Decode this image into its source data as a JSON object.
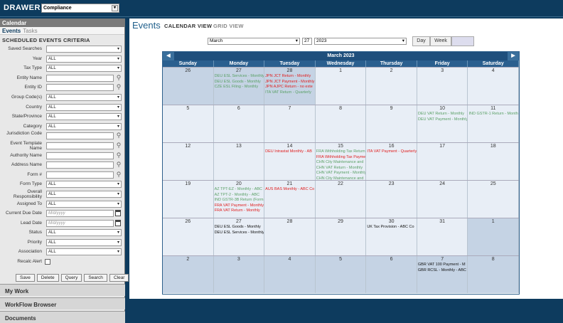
{
  "drawer": {
    "label": "DRAWER :",
    "value": "Compliance"
  },
  "sidebar": {
    "header": "Calendar",
    "tabs": [
      "Events",
      "Tasks"
    ],
    "criteria_title": "SCHEDULED EVENTS CRITERIA",
    "fields": [
      {
        "label": "Saved Searches",
        "type": "select",
        "value": ""
      },
      {
        "label": "Year",
        "type": "select",
        "value": "ALL"
      },
      {
        "label": "Tax Type",
        "type": "select",
        "value": "ALL"
      },
      {
        "label": "Entity Name",
        "type": "lookup",
        "value": ""
      },
      {
        "label": "Entity ID",
        "type": "lookup",
        "value": ""
      },
      {
        "label": "Group Code(s)",
        "type": "select",
        "value": "ALL"
      },
      {
        "label": "Country",
        "type": "select",
        "value": "ALL"
      },
      {
        "label": "State/Province",
        "type": "select",
        "value": "ALL"
      },
      {
        "label": "Category",
        "type": "select",
        "value": "ALL"
      },
      {
        "label": "Jurisdiction Code",
        "type": "lookup",
        "value": ""
      },
      {
        "label": "Event Template Name",
        "type": "lookup",
        "value": ""
      },
      {
        "label": "Authority Name",
        "type": "lookup",
        "value": ""
      },
      {
        "label": "Address Name",
        "type": "lookup",
        "value": ""
      },
      {
        "label": "Form #",
        "type": "lookup",
        "value": ""
      },
      {
        "label": "Form Type",
        "type": "select",
        "value": "ALL"
      },
      {
        "label": "Overall Responsibility",
        "type": "select",
        "value": "ALL"
      },
      {
        "label": "Assigned To",
        "type": "select",
        "value": "ALL"
      },
      {
        "label": "Current Due Date",
        "type": "date",
        "value": "M/d/yyyy"
      },
      {
        "label": "Lead Date",
        "type": "date",
        "value": "M/d/yyyy"
      },
      {
        "label": "Status",
        "type": "select",
        "value": "ALL"
      },
      {
        "label": "Priority",
        "type": "select",
        "value": "ALL"
      },
      {
        "label": "Association",
        "type": "select",
        "value": "ALL"
      },
      {
        "label": "Recalc Alert",
        "type": "check",
        "value": ""
      }
    ],
    "buttons": [
      "Save",
      "Delete",
      "Query",
      "Search",
      "Clear"
    ],
    "accordions": [
      "My Work",
      "WorkFlow Browser",
      "Documents"
    ]
  },
  "main": {
    "title": "Events",
    "views": [
      "CALENDAR VIEW",
      "GRID VIEW"
    ],
    "month_select": "March",
    "day_input": "27",
    "year_select": "2023",
    "view_buttons": [
      "Day",
      "Week",
      "Month"
    ],
    "calendar_title": "March 2023",
    "dows": [
      "Sunday",
      "Monday",
      "Tuesday",
      "Wednesday",
      "Thursday",
      "Friday",
      "Saturday"
    ],
    "weeks": [
      [
        {
          "d": "26",
          "o": true,
          "ev": []
        },
        {
          "d": "27",
          "o": true,
          "ev": [
            [
              "g",
              "DEU ESL Services - Monthly"
            ],
            [
              "g",
              "DEU ESL Goods - Monthly"
            ],
            [
              "g",
              "CZE ESL Filing - Monthly"
            ]
          ]
        },
        {
          "d": "28",
          "o": true,
          "ev": [
            [
              "r",
              "JPN JCT Return - Monthly"
            ],
            [
              "r",
              "JPN JCT Payment - Monthly"
            ],
            [
              "r",
              "JPN AJPC Return - no exte"
            ],
            [
              "g",
              "ITA VAT Return - Quarterly"
            ]
          ]
        },
        {
          "d": "1",
          "ev": []
        },
        {
          "d": "2",
          "ev": []
        },
        {
          "d": "3",
          "ev": []
        },
        {
          "d": "4",
          "ev": []
        }
      ],
      [
        {
          "d": "5",
          "ev": []
        },
        {
          "d": "6",
          "ev": []
        },
        {
          "d": "7",
          "ev": []
        },
        {
          "d": "8",
          "ev": []
        },
        {
          "d": "9",
          "ev": []
        },
        {
          "d": "10",
          "ev": [
            [
              "g",
              "DEU VAT Return - Monthly"
            ],
            [
              "g",
              "DEU VAT Payment - Monthly"
            ]
          ]
        },
        {
          "d": "11",
          "ev": [
            [
              "g",
              "IND GSTR-1 Return - Monthly"
            ]
          ]
        }
      ],
      [
        {
          "d": "12",
          "ev": []
        },
        {
          "d": "13",
          "ev": []
        },
        {
          "d": "14",
          "ev": [
            [
              "r",
              "DEU Intrastat Monthly - AB"
            ]
          ]
        },
        {
          "d": "15",
          "ev": [
            [
              "g",
              "FRA Withholding Tax Return"
            ],
            [
              "r",
              "FRA Withholding Tax Payment"
            ],
            [
              "g",
              "CHN City Maintenance and"
            ],
            [
              "g",
              "CHN VAT Return - Monthly"
            ],
            [
              "g",
              "CHN VAT Payment - Monthly"
            ],
            [
              "g",
              "CHN City Maintenance and"
            ]
          ]
        },
        {
          "d": "16",
          "ev": [
            [
              "r",
              "ITA VAT Payment - Quarterly"
            ]
          ]
        },
        {
          "d": "17",
          "ev": []
        },
        {
          "d": "18",
          "ev": []
        }
      ],
      [
        {
          "d": "19",
          "ev": []
        },
        {
          "d": "20",
          "ev": [
            [
              "g",
              "AZ TPT-EZ - Monthly - ABC"
            ],
            [
              "g",
              "AZ TPT-2 - Monthly - ABC"
            ],
            [
              "g",
              "IND GSTR-3B Return (Form"
            ],
            [
              "r",
              "FRA VAT Payment - Monthly"
            ],
            [
              "r",
              "FRA VAT Return - Monthly"
            ]
          ]
        },
        {
          "d": "21",
          "ev": [
            [
              "r",
              "AUS BAS Monthly - ABC Co"
            ]
          ]
        },
        {
          "d": "22",
          "ev": []
        },
        {
          "d": "23",
          "ev": []
        },
        {
          "d": "24",
          "ev": []
        },
        {
          "d": "25",
          "ev": []
        }
      ],
      [
        {
          "d": "26",
          "ev": []
        },
        {
          "d": "27",
          "ev": [
            [
              "k",
              "DEU ESL Goods - Monthly"
            ],
            [
              "k",
              "DEU ESL Services - Monthly"
            ]
          ]
        },
        {
          "d": "28",
          "ev": []
        },
        {
          "d": "29",
          "ev": []
        },
        {
          "d": "30",
          "ev": [
            [
              "k",
              "UK Tax Provision - ABC Co"
            ]
          ]
        },
        {
          "d": "31",
          "ev": []
        },
        {
          "d": "1",
          "o": true,
          "ev": []
        }
      ],
      [
        {
          "d": "2",
          "o": true,
          "ev": []
        },
        {
          "d": "3",
          "o": true,
          "ev": []
        },
        {
          "d": "4",
          "o": true,
          "ev": []
        },
        {
          "d": "5",
          "o": true,
          "ev": []
        },
        {
          "d": "6",
          "o": true,
          "ev": []
        },
        {
          "d": "7",
          "o": true,
          "ev": [
            [
              "k",
              "GBR VAT 100 Payment - M"
            ],
            [
              "k",
              "GBR RCSL - Monthly - ABC"
            ]
          ]
        },
        {
          "d": "8",
          "o": true,
          "ev": []
        }
      ]
    ]
  }
}
